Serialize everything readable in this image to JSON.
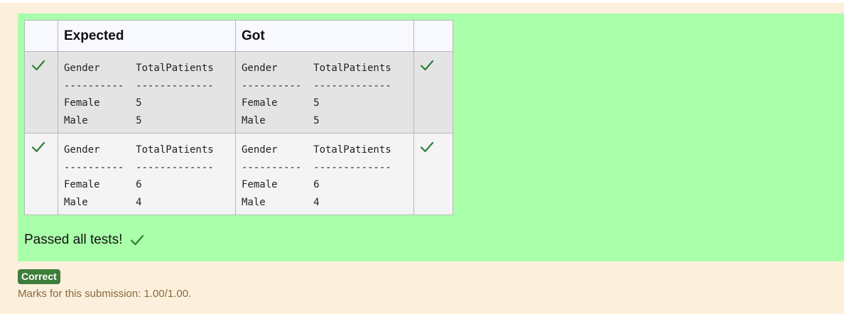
{
  "table": {
    "headers": [
      "",
      "Expected",
      "Got",
      ""
    ],
    "rows": [
      {
        "expected": "Gender      TotalPatients\n----------  -------------\nFemale      5\nMale        5",
        "got": "Gender      TotalPatients\n----------  -------------\nFemale      5\nMale        5"
      },
      {
        "expected": "Gender      TotalPatients\n----------  -------------\nFemale      6\nMale        4",
        "got": "Gender      TotalPatients\n----------  -------------\nFemale      6\nMale        4"
      }
    ]
  },
  "summary": {
    "passed_text": "Passed all tests!"
  },
  "grade": {
    "badge": "Correct",
    "marks": "Marks for this submission: 1.00/1.00."
  },
  "icons": {
    "pass": "check-icon"
  },
  "colors": {
    "panel": "#aaffaa",
    "background": "#fcefdc",
    "badge": "#3d7d3a",
    "check": "#2e7d32"
  }
}
